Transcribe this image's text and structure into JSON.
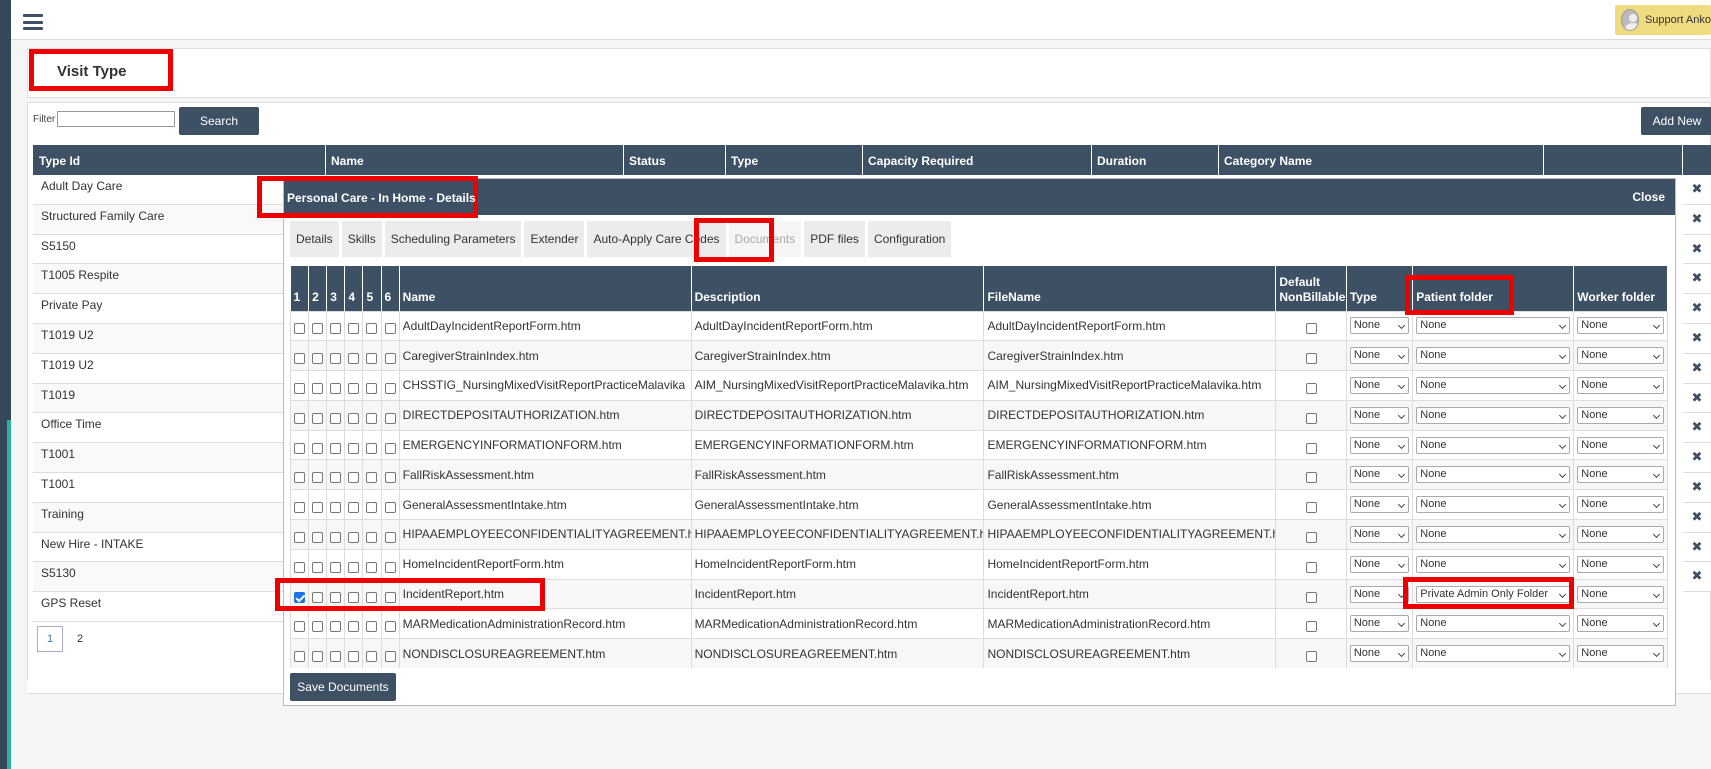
{
  "user": {
    "name": "Support Anko"
  },
  "page": {
    "title": "Visit Type"
  },
  "toolbar": {
    "filter_label": "Filter",
    "filter_value": "",
    "search_label": "Search",
    "addnew_label": "Add New"
  },
  "grid": {
    "columns": [
      "Type Id",
      "Name",
      "Status",
      "Type",
      "Capacity Required",
      "Duration",
      "Category Name"
    ],
    "rows": [
      "Adult Day Care",
      "Structured Family Care",
      "S5150",
      "T1005 Respite",
      "Private Pay",
      "T1019 U2",
      "T1019 U2",
      "T1019",
      "Office Time",
      "T1001",
      "T1001",
      "Training",
      "New Hire - INTAKE",
      "S5130",
      "GPS Reset"
    ],
    "pages": [
      "1",
      "2"
    ]
  },
  "modal": {
    "title": "Personal Care - In Home - Details",
    "close_label": "Close",
    "tabs": [
      "Details",
      "Skills",
      "Scheduling Parameters",
      "Extender",
      "Auto-Apply Care Codes",
      "Documents",
      "PDF files",
      "Configuration"
    ],
    "active_tab": "Documents",
    "save_label": "Save Documents"
  },
  "documents": {
    "columns": {
      "c1": "1",
      "c2": "2",
      "c3": "3",
      "c4": "4",
      "c5": "5",
      "c6": "6",
      "name": "Name",
      "description": "Description",
      "filename": "FileName",
      "nonbillable": "Default NonBillable",
      "type": "Type",
      "patient_folder": "Patient folder",
      "worker_folder": "Worker folder"
    },
    "rows": [
      {
        "name": "AdultDayIncidentReportForm.htm",
        "description": "AdultDayIncidentReportForm.htm",
        "filename": "AdultDayIncidentReportForm.htm",
        "checked": [
          false,
          false,
          false,
          false,
          false,
          false
        ],
        "type": "None",
        "patient_folder": "None",
        "worker_folder": "None"
      },
      {
        "name": "CaregiverStrainIndex.htm",
        "description": "CaregiverStrainIndex.htm",
        "filename": "CaregiverStrainIndex.htm",
        "checked": [
          false,
          false,
          false,
          false,
          false,
          false
        ],
        "type": "None",
        "patient_folder": "None",
        "worker_folder": "None"
      },
      {
        "name": "CHSSTIG_NursingMixedVisitReportPracticeMalavika",
        "description": "AIM_NursingMixedVisitReportPracticeMalavika.htm",
        "filename": "AIM_NursingMixedVisitReportPracticeMalavika.htm",
        "checked": [
          false,
          false,
          false,
          false,
          false,
          false
        ],
        "type": "None",
        "patient_folder": "None",
        "worker_folder": "None"
      },
      {
        "name": "DIRECTDEPOSITAUTHORIZATION.htm",
        "description": "DIRECTDEPOSITAUTHORIZATION.htm",
        "filename": "DIRECTDEPOSITAUTHORIZATION.htm",
        "checked": [
          false,
          false,
          false,
          false,
          false,
          false
        ],
        "type": "None",
        "patient_folder": "None",
        "worker_folder": "None"
      },
      {
        "name": "EMERGENCYINFORMATIONFORM.htm",
        "description": "EMERGENCYINFORMATIONFORM.htm",
        "filename": "EMERGENCYINFORMATIONFORM.htm",
        "checked": [
          false,
          false,
          false,
          false,
          false,
          false
        ],
        "type": "None",
        "patient_folder": "None",
        "worker_folder": "None"
      },
      {
        "name": "FallRiskAssessment.htm",
        "description": "FallRiskAssessment.htm",
        "filename": "FallRiskAssessment.htm",
        "checked": [
          false,
          false,
          false,
          false,
          false,
          false
        ],
        "type": "None",
        "patient_folder": "None",
        "worker_folder": "None"
      },
      {
        "name": "GeneralAssessmentIntake.htm",
        "description": "GeneralAssessmentIntake.htm",
        "filename": "GeneralAssessmentIntake.htm",
        "checked": [
          false,
          false,
          false,
          false,
          false,
          false
        ],
        "type": "None",
        "patient_folder": "None",
        "worker_folder": "None"
      },
      {
        "name": "HIPAAEMPLOYEECONFIDENTIALITYAGREEMENT.htm",
        "description": "HIPAAEMPLOYEECONFIDENTIALITYAGREEMENT.htm",
        "filename": "HIPAAEMPLOYEECONFIDENTIALITYAGREEMENT.htm",
        "checked": [
          false,
          false,
          false,
          false,
          false,
          false
        ],
        "type": "None",
        "patient_folder": "None",
        "worker_folder": "None"
      },
      {
        "name": "HomeIncidentReportForm.htm",
        "description": "HomeIncidentReportForm.htm",
        "filename": "HomeIncidentReportForm.htm",
        "checked": [
          false,
          false,
          false,
          false,
          false,
          false
        ],
        "type": "None",
        "patient_folder": "None",
        "worker_folder": "None"
      },
      {
        "name": "IncidentReport.htm",
        "description": "IncidentReport.htm",
        "filename": "IncidentReport.htm",
        "checked": [
          true,
          false,
          false,
          false,
          false,
          false
        ],
        "type": "None",
        "patient_folder": "Private Admin Only Folder",
        "worker_folder": "None"
      },
      {
        "name": "MARMedicationAdministrationRecord.htm",
        "description": "MARMedicationAdministrationRecord.htm",
        "filename": "MARMedicationAdministrationRecord.htm",
        "checked": [
          false,
          false,
          false,
          false,
          false,
          false
        ],
        "type": "None",
        "patient_folder": "None",
        "worker_folder": "None"
      },
      {
        "name": "NONDISCLOSUREAGREEMENT.htm",
        "description": "NONDISCLOSUREAGREEMENT.htm",
        "filename": "NONDISCLOSUREAGREEMENT.htm",
        "checked": [
          false,
          false,
          false,
          false,
          false,
          false
        ],
        "type": "None",
        "patient_folder": "None",
        "worker_folder": "None"
      }
    ]
  },
  "colors": {
    "header": "#3e5064",
    "highlight": "#e00000",
    "user_pill": "#f0dc80",
    "checkbox_on": "#1a73e8"
  },
  "icons": {
    "menu": "hamburger-icon",
    "delete": "x-icon",
    "user": "avatar-icon"
  }
}
